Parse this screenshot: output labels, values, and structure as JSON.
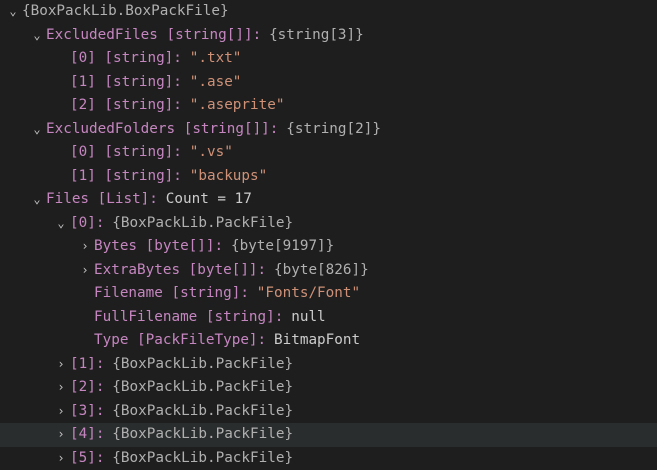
{
  "chevrons": {
    "expanded": "⌄",
    "collapsed": "›"
  },
  "rows": [
    {
      "depth": 0,
      "state": "expanded",
      "key": "",
      "value": "{BoxPackLib.BoxPackFile}",
      "vtype": "obj"
    },
    {
      "depth": 1,
      "state": "expanded",
      "key": "ExcludedFiles [string[]]",
      "value": "{string[3]}",
      "vtype": "obj"
    },
    {
      "depth": 2,
      "state": "leaf",
      "key": "[0] [string]",
      "value": "\".txt\"",
      "vtype": "str"
    },
    {
      "depth": 2,
      "state": "leaf",
      "key": "[1] [string]",
      "value": "\".ase\"",
      "vtype": "str"
    },
    {
      "depth": 2,
      "state": "leaf",
      "key": "[2] [string]",
      "value": "\".aseprite\"",
      "vtype": "str"
    },
    {
      "depth": 1,
      "state": "expanded",
      "key": "ExcludedFolders [string[]]",
      "value": "{string[2]}",
      "vtype": "obj"
    },
    {
      "depth": 2,
      "state": "leaf",
      "key": "[0] [string]",
      "value": "\".vs\"",
      "vtype": "str"
    },
    {
      "depth": 2,
      "state": "leaf",
      "key": "[1] [string]",
      "value": "\"backups\"",
      "vtype": "str"
    },
    {
      "depth": 1,
      "state": "expanded",
      "key": "Files [List]",
      "value": "Count = 17",
      "vtype": "plain"
    },
    {
      "depth": 2,
      "state": "expanded",
      "key": "[0]",
      "value": "{BoxPackLib.PackFile}",
      "vtype": "obj"
    },
    {
      "depth": 3,
      "state": "collapsed",
      "key": "Bytes [byte[]]",
      "value": "{byte[9197]}",
      "vtype": "obj"
    },
    {
      "depth": 3,
      "state": "collapsed",
      "key": "ExtraBytes [byte[]]",
      "value": "{byte[826]}",
      "vtype": "obj"
    },
    {
      "depth": 3,
      "state": "leaf",
      "key": "Filename [string]",
      "value": "\"Fonts/Font\"",
      "vtype": "str"
    },
    {
      "depth": 3,
      "state": "leaf",
      "key": "FullFilename [string]",
      "value": "null",
      "vtype": "plain"
    },
    {
      "depth": 3,
      "state": "leaf",
      "key": "Type [PackFileType]",
      "value": "BitmapFont",
      "vtype": "plain"
    },
    {
      "depth": 2,
      "state": "collapsed",
      "key": "[1]",
      "value": "{BoxPackLib.PackFile}",
      "vtype": "obj"
    },
    {
      "depth": 2,
      "state": "collapsed",
      "key": "[2]",
      "value": "{BoxPackLib.PackFile}",
      "vtype": "obj"
    },
    {
      "depth": 2,
      "state": "collapsed",
      "key": "[3]",
      "value": "{BoxPackLib.PackFile}",
      "vtype": "obj"
    },
    {
      "depth": 2,
      "state": "collapsed",
      "key": "[4]",
      "value": "{BoxPackLib.PackFile}",
      "vtype": "obj",
      "selected": true
    },
    {
      "depth": 2,
      "state": "collapsed",
      "key": "[5]",
      "value": "{BoxPackLib.PackFile}",
      "vtype": "obj"
    }
  ]
}
